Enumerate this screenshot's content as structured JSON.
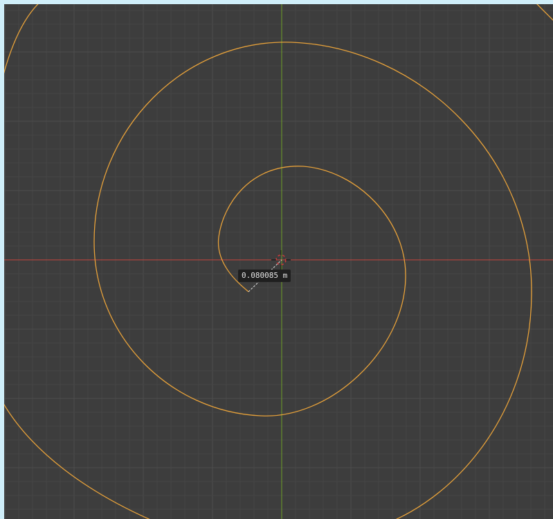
{
  "viewport": {
    "background_color": "#3d3d3d",
    "frame_color": "#cfeef9",
    "grid": true,
    "grid_minor_color": "#454545",
    "grid_major_color": "#4d4d4d",
    "x_axis_color": "#c8453d",
    "y_axis_color": "#6fa128",
    "curve_color": "#e8a23a",
    "curve_type": "spiral"
  },
  "cursor": {
    "icon": "3d-cursor-icon",
    "ring_colors": [
      "#ffffff",
      "#d23a3a"
    ]
  },
  "measure": {
    "label": "0.080085 m",
    "line_color": "#e6e6e6"
  }
}
